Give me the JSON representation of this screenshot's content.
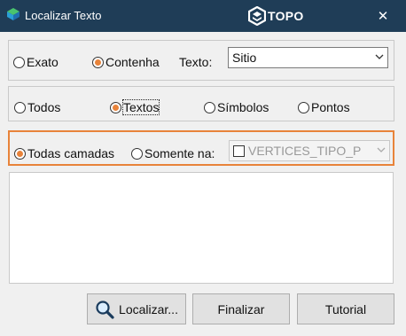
{
  "window": {
    "title": "Localizar Texto",
    "brand": "TOPO",
    "close_symbol": "✕"
  },
  "match_mode": {
    "options": [
      {
        "label": "Exato",
        "selected": false
      },
      {
        "label": "Contenha",
        "selected": true
      }
    ],
    "text_label": "Texto:",
    "text_value": "Sitio"
  },
  "object_type": {
    "options": [
      {
        "label": "Todos",
        "selected": false
      },
      {
        "label": "Textos",
        "selected": true
      },
      {
        "label": "Símbolos",
        "selected": false
      },
      {
        "label": "Pontos",
        "selected": false
      }
    ]
  },
  "layers": {
    "options": [
      {
        "label": "Todas camadas",
        "selected": true
      },
      {
        "label": "Somente na:",
        "selected": false
      }
    ],
    "layer_value": "VERTICES_TIPO_P",
    "layer_enabled": false
  },
  "buttons": {
    "search": "Localizar...",
    "finish": "Finalizar",
    "tutorial": "Tutorial"
  },
  "colors": {
    "titlebar": "#1f3d57",
    "accent": "#e8833a"
  },
  "icons": [
    "app-icon",
    "topo-logo-icon",
    "close-icon",
    "chevron-down-icon",
    "magnifier-icon"
  ]
}
